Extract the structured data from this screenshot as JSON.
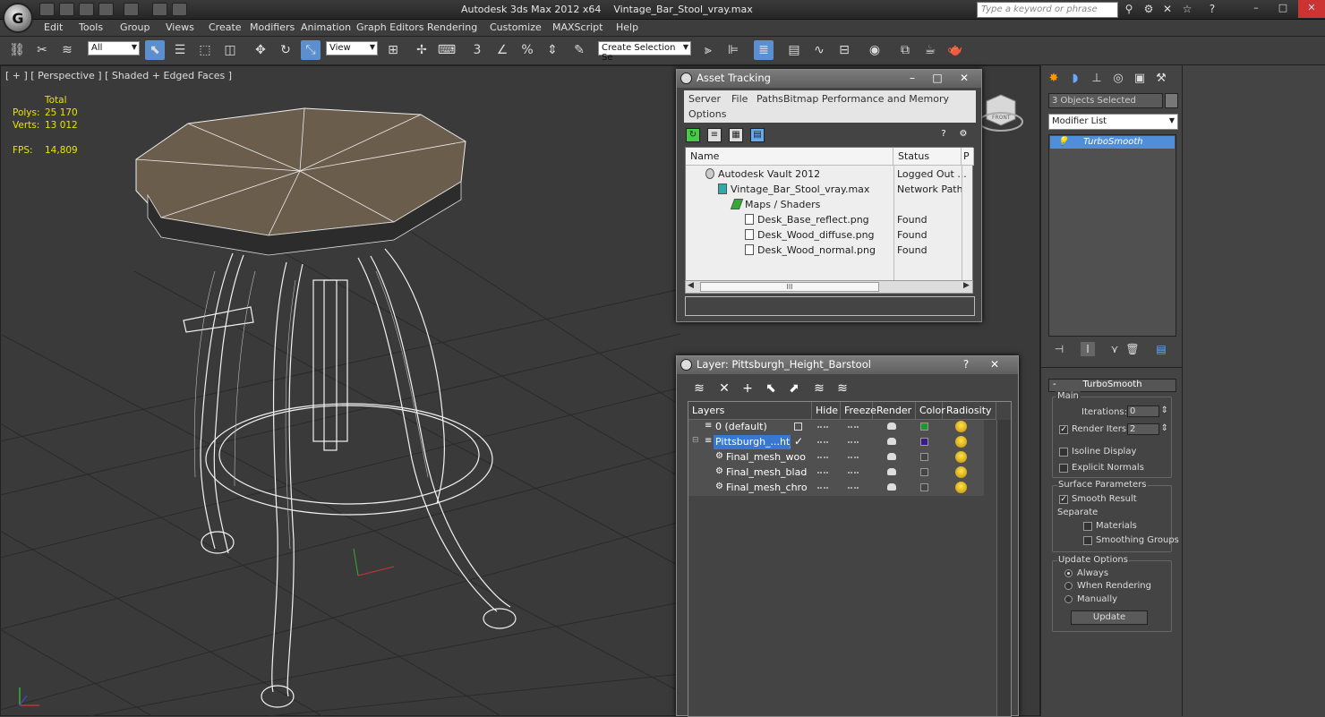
{
  "title_bar": {
    "app_title": "Autodesk 3ds Max  2012 x64",
    "file_name": "Vintage_Bar_Stool_vray.max",
    "search_placeholder": "Type a keyword or phrase"
  },
  "menu": [
    "Edit",
    "Tools",
    "Group",
    "Views",
    "Create",
    "Modifiers",
    "Animation",
    "Graph Editors",
    "Rendering",
    "Customize",
    "MAXScript",
    "Help"
  ],
  "toolbar": {
    "filter_value": "All",
    "refcoord_value": "View",
    "selection_set_value": "Create Selection Se"
  },
  "viewport": {
    "label": "[ + ] [ Perspective ] [ Shaded + Edged Faces ]",
    "stats": {
      "total_label": "Total",
      "polys_label": "Polys:",
      "polys_value": "25 170",
      "verts_label": "Verts:",
      "verts_value": "13 012",
      "fps_label": "FPS:",
      "fps_value": "14,809"
    },
    "viewcube_label": "FRONT"
  },
  "asset_tracking": {
    "title": "Asset Tracking",
    "menu": [
      "Server",
      "File",
      "Paths",
      "Bitmap Performance and Memory",
      "Options"
    ],
    "columns": [
      "Name",
      "Status",
      "P"
    ],
    "rows": [
      {
        "name": "Autodesk Vault 2012",
        "status": "Logged Out ..."
      },
      {
        "name": "Vintage_Bar_Stool_vray.max",
        "status": "Network Path"
      },
      {
        "name": "Maps / Shaders",
        "status": ""
      },
      {
        "name": "Desk_Base_reflect.png",
        "status": "Found"
      },
      {
        "name": "Desk_Wood_diffuse.png",
        "status": "Found"
      },
      {
        "name": "Desk_Wood_normal.png",
        "status": "Found"
      }
    ],
    "scroll_glyph": "III"
  },
  "layer_dialog": {
    "title": "Layer: Pittsburgh_Height_Barstool",
    "columns": [
      "Layers",
      "Hide",
      "Freeze",
      "Render",
      "Color",
      "Radiosity"
    ],
    "rows": [
      {
        "name": "0 (default)",
        "color": "#1a9a2a"
      },
      {
        "name": "Pittsburgh_...ht_Ba",
        "color": "#3a1a8a"
      },
      {
        "name": "Final_mesh_woo",
        "color": "#444444"
      },
      {
        "name": "Final_mesh_blad",
        "color": "#444444"
      },
      {
        "name": "Final_mesh_chro",
        "color": "#444444"
      }
    ]
  },
  "command_panel": {
    "selection": "3 Objects Selected",
    "modifier_list": "Modifier List",
    "stack_item": "TurboSmooth",
    "rollout_title": "TurboSmooth",
    "rollout_minus": "-",
    "main_group": "Main",
    "iterations_label": "Iterations:",
    "iterations_value": "0",
    "render_iters_label": "Render Iters:",
    "render_iters_value": "2",
    "isoline_label": "Isoline Display",
    "explicit_label": "Explicit Normals",
    "surface_group": "Surface Parameters",
    "smooth_result_label": "Smooth Result",
    "separate_label": "Separate",
    "materials_label": "Materials",
    "smoothing_groups_label": "Smoothing Groups",
    "update_group": "Update Options",
    "always_label": "Always",
    "when_rendering_label": "When Rendering",
    "manually_label": "Manually",
    "update_button": "Update"
  }
}
